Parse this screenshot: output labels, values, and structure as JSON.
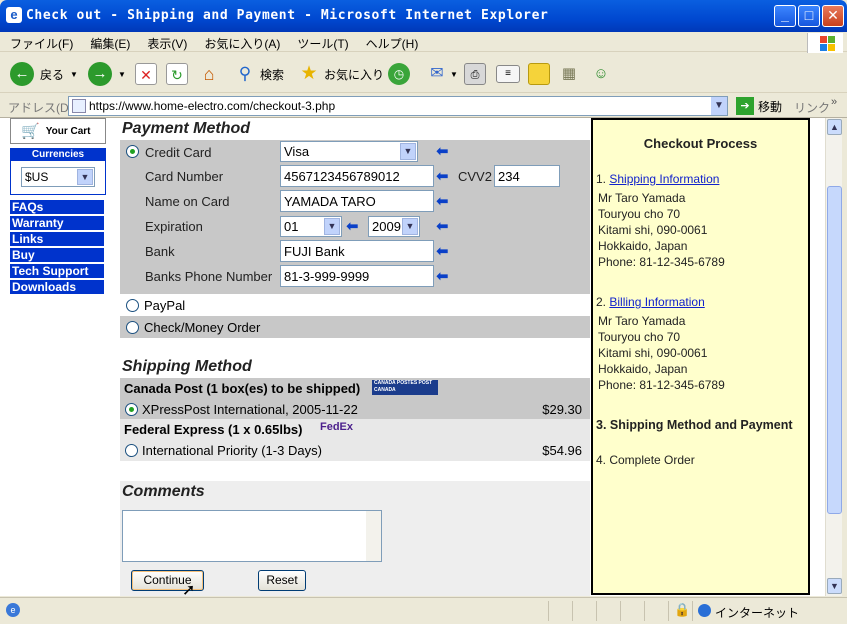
{
  "window": {
    "title": "Check out - Shipping and Payment - Microsoft Internet Explorer"
  },
  "menu": [
    "ファイル(F)",
    "編集(E)",
    "表示(V)",
    "お気に入り(A)",
    "ツール(T)",
    "ヘルプ(H)"
  ],
  "toolbar": {
    "back": "戻る",
    "search": "検索",
    "favorites": "お気に入り"
  },
  "address": {
    "label": "アドレス(D)",
    "url": "https://www.home-electro.com/checkout-3.php",
    "go": "移動",
    "links": "リンク"
  },
  "sidebar": {
    "cart": "Your Cart",
    "currencies_heading": "Currencies",
    "currency": "$US",
    "links": [
      "FAQs",
      "Warranty",
      "Links",
      "Buy",
      "Tech Support",
      "Downloads"
    ]
  },
  "payment": {
    "title": "Payment Method",
    "credit_card_label": "Credit Card",
    "card_type": "Visa",
    "card_number_label": "Card Number",
    "card_number": "4567123456789012",
    "cvv_label": "CVV2",
    "cvv": "234",
    "name_label": "Name on Card",
    "name": "YAMADA TARO",
    "expiration_label": "Expiration",
    "exp_month": "01",
    "exp_year": "2009",
    "bank_label": "Bank",
    "bank": "FUJI Bank",
    "bank_phone_label": "Banks Phone Number",
    "bank_phone": "81-3-999-9999",
    "paypal_label": "PayPal",
    "check_label": "Check/Money Order"
  },
  "shipping": {
    "title": "Shipping Method",
    "carrier1": "Canada Post (1 box(es) to be shipped)",
    "carrier1_logo": "CANADA POSTES POST CANADA",
    "option1": "XPressPost International, 2005-11-22",
    "option1_price": "$29.30",
    "carrier2": "Federal Express (1 x 0.65lbs)",
    "carrier2_logo": "FedEx",
    "option2": "International Priority (1-3 Days)",
    "option2_price": "$54.96"
  },
  "comments": {
    "title": "Comments"
  },
  "buttons": {
    "continue": "Continue",
    "reset": "Reset"
  },
  "checkout_panel": {
    "title": "Checkout Process",
    "step1_num": "1.",
    "step1": "Shipping Information",
    "shipping_address": [
      "Mr Taro Yamada",
      "Touryou cho 70",
      "Kitami shi, 090-0061",
      "Hokkaido, Japan",
      "Phone: 81-12-345-6789"
    ],
    "step2_num": "2.",
    "step2": "Billing Information",
    "billing_address": [
      "Mr Taro Yamada",
      "Touryou cho 70",
      "Kitami shi, 090-0061",
      "Hokkaido, Japan",
      "Phone: 81-12-345-6789"
    ],
    "step3": "3. Shipping Method and Payment",
    "step4": "4. Complete Order"
  },
  "status": {
    "zone": "インターネット"
  }
}
